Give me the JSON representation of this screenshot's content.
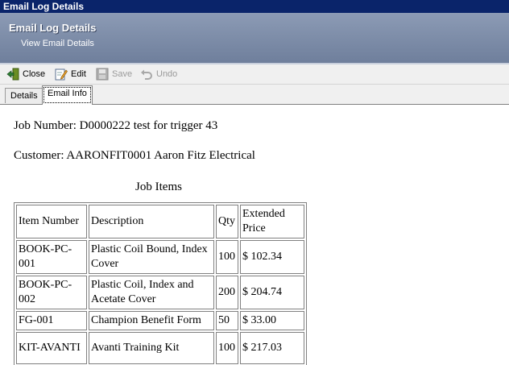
{
  "window": {
    "title": "Email Log Details"
  },
  "banner": {
    "title": "Email Log Details",
    "subtitle": "View Email Details"
  },
  "toolbar": {
    "close_label": "Close",
    "edit_label": "Edit",
    "save_label": "Save",
    "undo_label": "Undo",
    "icons": {
      "close": "close-door-icon",
      "edit": "edit-pencil-icon",
      "save": "save-disk-icon",
      "undo": "undo-icon"
    }
  },
  "tabs": [
    {
      "label": "Details",
      "active": false
    },
    {
      "label": "Email Info",
      "active": true
    }
  ],
  "email": {
    "job_line": "Job Number: D0000222  test for trigger 43",
    "customer_line": "Customer: AARONFIT0001  Aaron Fitz Electrical",
    "items_caption": "Job Items",
    "columns": [
      "Item Number",
      "Description",
      "Qty",
      "Extended Price"
    ],
    "rows": [
      [
        "BOOK-PC-001",
        "Plastic Coil Bound, Index Cover",
        "100",
        "$ 102.34"
      ],
      [
        "BOOK-PC-002",
        "Plastic Coil, Index and Acetate Cover",
        "200",
        "$ 204.74"
      ],
      [
        "FG-001",
        "Champion Benefit Form",
        "50",
        "$ 33.00"
      ],
      [
        "KIT-AVANTI",
        "Avanti Training Kit",
        "100",
        "$ 217.03"
      ]
    ]
  },
  "colors": {
    "titlebar": "#0a246a",
    "banner": "#7a89a6",
    "toolbar": "#f0f0f0"
  }
}
